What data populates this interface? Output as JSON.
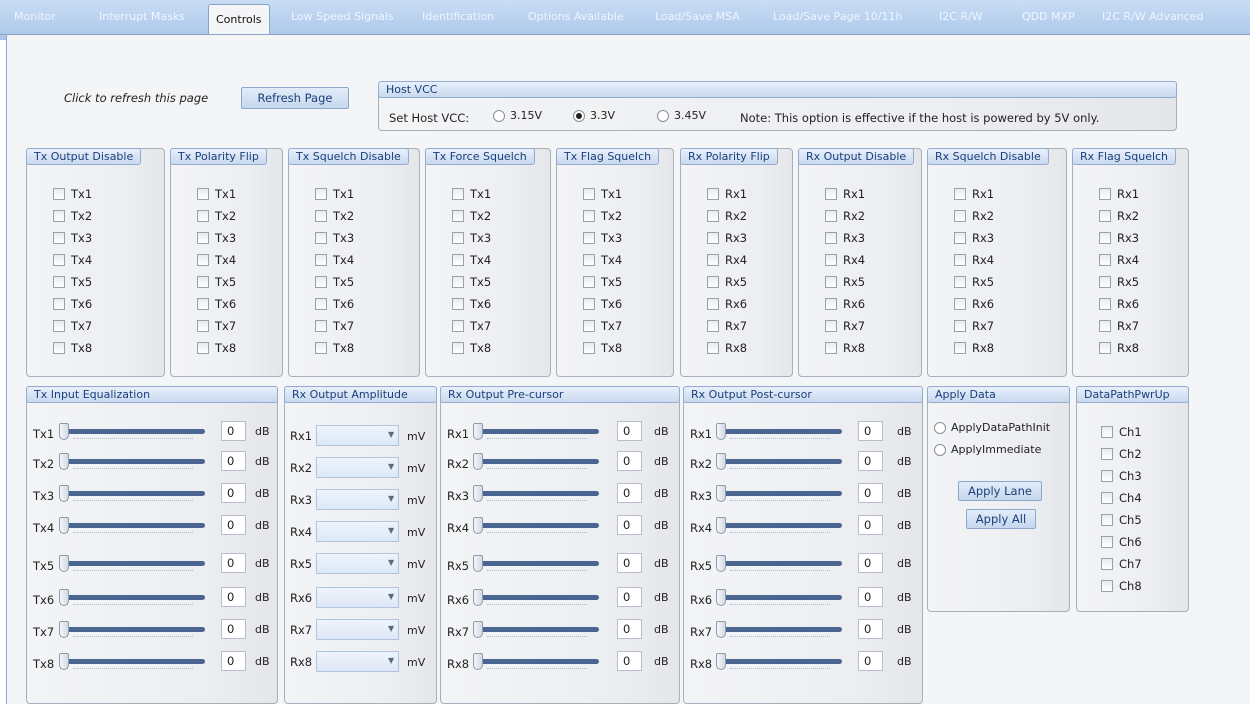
{
  "tabs": [
    {
      "label": "Monitor",
      "active": false
    },
    {
      "label": "Interrupt Masks",
      "active": false
    },
    {
      "label": "Controls",
      "active": true
    },
    {
      "label": "Low Speed Signals",
      "active": false
    },
    {
      "label": "Identification",
      "active": false
    },
    {
      "label": "Options Available",
      "active": false
    },
    {
      "label": "Load/Save MSA",
      "active": false
    },
    {
      "label": "Load/Save Page 10/11h",
      "active": false
    },
    {
      "label": "I2C R/W",
      "active": false
    },
    {
      "label": "QDD MXP",
      "active": false
    },
    {
      "label": "I2C R/W Advanced",
      "active": false
    }
  ],
  "refresh": {
    "label": "Click to refresh this page",
    "button": "Refresh Page"
  },
  "host_vcc": {
    "title": "Host VCC",
    "set_label": "Set Host VCC:",
    "options": [
      {
        "label": "3.15V",
        "selected": false
      },
      {
        "label": "3.3V",
        "selected": true
      },
      {
        "label": "3.45V",
        "selected": false
      }
    ],
    "note": "Note: This option is effective if the host is powered by 5V only."
  },
  "checkbox_groups": [
    {
      "title": "Tx Output Disable",
      "items": [
        "Tx1",
        "Tx2",
        "Tx3",
        "Tx4",
        "Tx5",
        "Tx6",
        "Tx7",
        "Tx8"
      ]
    },
    {
      "title": "Tx Polarity Flip",
      "items": [
        "Tx1",
        "Tx2",
        "Tx3",
        "Tx4",
        "Tx5",
        "Tx6",
        "Tx7",
        "Tx8"
      ]
    },
    {
      "title": "Tx Squelch Disable",
      "items": [
        "Tx1",
        "Tx2",
        "Tx3",
        "Tx4",
        "Tx5",
        "Tx6",
        "Tx7",
        "Tx8"
      ]
    },
    {
      "title": "Tx Force Squelch",
      "items": [
        "Tx1",
        "Tx2",
        "Tx3",
        "Tx4",
        "Tx5",
        "Tx6",
        "Tx7",
        "Tx8"
      ]
    },
    {
      "title": "Tx Flag Squelch",
      "items": [
        "Tx1",
        "Tx2",
        "Tx3",
        "Tx4",
        "Tx5",
        "Tx6",
        "Tx7",
        "Tx8"
      ]
    },
    {
      "title": "Rx Polarity Flip",
      "items": [
        "Rx1",
        "Rx2",
        "Rx3",
        "Rx4",
        "Rx5",
        "Rx6",
        "Rx7",
        "Rx8"
      ]
    },
    {
      "title": "Rx Output Disable",
      "items": [
        "Rx1",
        "Rx2",
        "Rx3",
        "Rx4",
        "Rx5",
        "Rx6",
        "Rx7",
        "Rx8"
      ]
    },
    {
      "title": "Rx Squelch Disable",
      "items": [
        "Rx1",
        "Rx2",
        "Rx3",
        "Rx4",
        "Rx5",
        "Rx6",
        "Rx7",
        "Rx8"
      ]
    },
    {
      "title": "Rx Flag Squelch",
      "items": [
        "Rx1",
        "Rx2",
        "Rx3",
        "Rx4",
        "Rx5",
        "Rx6",
        "Rx7",
        "Rx8"
      ]
    }
  ],
  "tx_input_eq": {
    "title": "Tx Input Equalization",
    "unit": "dB",
    "rows": [
      {
        "label": "Tx1",
        "value": "0"
      },
      {
        "label": "Tx2",
        "value": "0"
      },
      {
        "label": "Tx3",
        "value": "0"
      },
      {
        "label": "Tx4",
        "value": "0"
      },
      {
        "label": "Tx5",
        "value": "0"
      },
      {
        "label": "Tx6",
        "value": "0"
      },
      {
        "label": "Tx7",
        "value": "0"
      },
      {
        "label": "Tx8",
        "value": "0"
      }
    ]
  },
  "rx_output_amplitude": {
    "title": "Rx Output Amplitude",
    "unit": "mV",
    "rows": [
      {
        "label": "Rx1",
        "value": ""
      },
      {
        "label": "Rx2",
        "value": ""
      },
      {
        "label": "Rx3",
        "value": ""
      },
      {
        "label": "Rx4",
        "value": ""
      },
      {
        "label": "Rx5",
        "value": ""
      },
      {
        "label": "Rx6",
        "value": ""
      },
      {
        "label": "Rx7",
        "value": ""
      },
      {
        "label": "Rx8",
        "value": ""
      }
    ]
  },
  "rx_pre_cursor": {
    "title": "Rx Output Pre-cursor",
    "unit": "dB",
    "rows": [
      {
        "label": "Rx1",
        "value": "0"
      },
      {
        "label": "Rx2",
        "value": "0"
      },
      {
        "label": "Rx3",
        "value": "0"
      },
      {
        "label": "Rx4",
        "value": "0"
      },
      {
        "label": "Rx5",
        "value": "0"
      },
      {
        "label": "Rx6",
        "value": "0"
      },
      {
        "label": "Rx7",
        "value": "0"
      },
      {
        "label": "Rx8",
        "value": "0"
      }
    ]
  },
  "rx_post_cursor": {
    "title": "Rx Output Post-cursor",
    "unit": "dB",
    "rows": [
      {
        "label": "Rx1",
        "value": "0"
      },
      {
        "label": "Rx2",
        "value": "0"
      },
      {
        "label": "Rx3",
        "value": "0"
      },
      {
        "label": "Rx4",
        "value": "0"
      },
      {
        "label": "Rx5",
        "value": "0"
      },
      {
        "label": "Rx6",
        "value": "0"
      },
      {
        "label": "Rx7",
        "value": "0"
      },
      {
        "label": "Rx8",
        "value": "0"
      }
    ]
  },
  "apply_data": {
    "title": "Apply Data",
    "options": [
      "ApplyDataPathInit",
      "ApplyImmediate"
    ],
    "apply_lane": "Apply Lane",
    "apply_all": "Apply All"
  },
  "datapath_pwrup": {
    "title": "DataPathPwrUp",
    "items": [
      "Ch1",
      "Ch2",
      "Ch3",
      "Ch4",
      "Ch5",
      "Ch6",
      "Ch7",
      "Ch8"
    ]
  }
}
